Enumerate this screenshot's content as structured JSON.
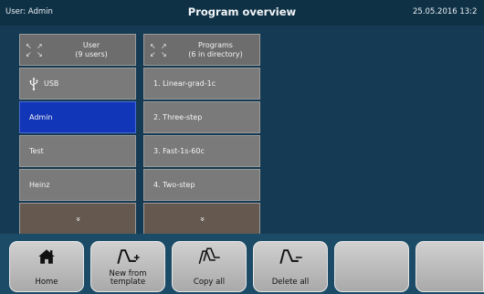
{
  "header": {
    "user": "User: Admin",
    "title": "Program overview",
    "date": "25.05.2016  13:2"
  },
  "users_column": {
    "header_line1": "User",
    "header_line2": "(9 users)",
    "items": [
      "USB",
      "Admin",
      "Test",
      "Heinz"
    ],
    "selected": "Admin",
    "more_symbol": "»"
  },
  "programs_column": {
    "header_line1": "Programs",
    "header_line2": "(6 in directory)",
    "items": [
      "1. Linear-grad-1c",
      "2. Three-step",
      "3. Fast-1s-60c",
      "4. Two-step"
    ],
    "more_symbol": "»"
  },
  "bottom_bar": {
    "buttons": [
      {
        "label_line1": "Home",
        "label_line2": "",
        "icon": "home-icon"
      },
      {
        "label_line1": "New from",
        "label_line2": "template",
        "icon": "new-from-template-icon"
      },
      {
        "label_line1": "Copy all",
        "label_line2": "",
        "icon": "copy-all-icon"
      },
      {
        "label_line1": "Delete all",
        "label_line2": "",
        "icon": "delete-all-icon"
      },
      {
        "label_line1": "",
        "label_line2": "",
        "icon": ""
      },
      {
        "label_line1": "",
        "label_line2": "",
        "icon": ""
      }
    ]
  },
  "colors": {
    "background": "#153b54",
    "header": "#0f3146",
    "cell": "#7a7a7a",
    "selected": "#1236b8",
    "more_row": "#65594f",
    "button": "#c2c2c2"
  }
}
